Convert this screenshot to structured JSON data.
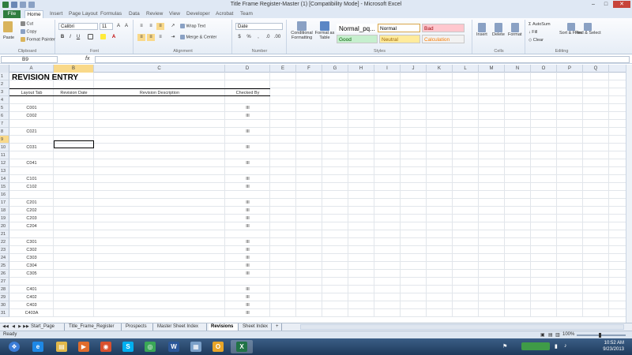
{
  "window": {
    "title": "Title Frame Register-Master (1) [Compatibility Mode] - Microsoft Excel"
  },
  "ribbon": {
    "tabs": [
      "File",
      "Home",
      "Insert",
      "Page Layout",
      "Formulas",
      "Data",
      "Review",
      "View",
      "Developer",
      "Acrobat",
      "Team"
    ],
    "clipboard": {
      "paste": "Paste",
      "cut": "Cut",
      "copy": "Copy",
      "format_painter": "Format Painter",
      "label": "Clipboard"
    },
    "font": {
      "name": "Calibri",
      "size": "11",
      "label": "Font"
    },
    "alignment": {
      "wrap_text": "Wrap Text",
      "merge_center": "Merge & Center",
      "label": "Alignment"
    },
    "number": {
      "format": "Date",
      "label": "Number"
    },
    "styles": {
      "conditional": "Conditional Formatting",
      "format_as_table": "Format as Table",
      "cell_styles": [
        {
          "name": "Normal_pq...",
          "bg": "#ffffff",
          "fg": "#000000"
        },
        {
          "name": "Normal",
          "bg": "#ffffff",
          "fg": "#000000"
        },
        {
          "name": "Bad",
          "bg": "#ffc7ce",
          "fg": "#9c0006"
        },
        {
          "name": "Good",
          "bg": "#c6efce",
          "fg": "#006100"
        },
        {
          "name": "Neutral",
          "bg": "#ffeb9c",
          "fg": "#9c6500"
        },
        {
          "name": "Calculation",
          "bg": "#f2f2f2",
          "fg": "#fa7d00"
        }
      ],
      "label": "Styles"
    },
    "cells": {
      "insert": "Insert",
      "delete": "Delete",
      "format": "Format",
      "label": "Cells"
    },
    "editing": {
      "autosum": "AutoSum",
      "fill": "Fill",
      "clear": "Clear",
      "sort_filter": "Sort & Filter",
      "find_select": "Find & Select",
      "label": "Editing"
    }
  },
  "formula_bar": {
    "name_box": "B9",
    "fx": "fx",
    "value": ""
  },
  "sheet": {
    "columns": [
      "A",
      "B",
      "C",
      "D",
      "E",
      "F",
      "G",
      "H",
      "I",
      "J",
      "K",
      "L",
      "M",
      "N",
      "O",
      "P",
      "Q"
    ],
    "selected_column": "B",
    "selected_row": "9",
    "title": "REVISION ENTRY",
    "headers": {
      "layout_tab": "Layout Tab",
      "revision_date": "Revision Date",
      "revision_description": "Revision Description",
      "checked_by": "Checked By"
    },
    "rows": [
      {
        "n": "1",
        "a": "",
        "d": ""
      },
      {
        "n": "2",
        "a": "",
        "d": ""
      },
      {
        "n": "3",
        "a": "",
        "d": ""
      },
      {
        "n": "4",
        "a": "",
        "d": ""
      },
      {
        "n": "5",
        "a": "C001",
        "d": "III"
      },
      {
        "n": "6",
        "a": "C002",
        "d": "III"
      },
      {
        "n": "7",
        "a": "",
        "d": ""
      },
      {
        "n": "8",
        "a": "C021",
        "d": "III"
      },
      {
        "n": "9",
        "a": "",
        "d": ""
      },
      {
        "n": "10",
        "a": "C031",
        "d": "III"
      },
      {
        "n": "11",
        "a": "",
        "d": ""
      },
      {
        "n": "12",
        "a": "C041",
        "d": "III"
      },
      {
        "n": "13",
        "a": "",
        "d": ""
      },
      {
        "n": "14",
        "a": "C101",
        "d": "III"
      },
      {
        "n": "15",
        "a": "C102",
        "d": "III"
      },
      {
        "n": "16",
        "a": "",
        "d": ""
      },
      {
        "n": "17",
        "a": "C201",
        "d": "III"
      },
      {
        "n": "18",
        "a": "C202",
        "d": "III"
      },
      {
        "n": "19",
        "a": "C203",
        "d": "III"
      },
      {
        "n": "20",
        "a": "C204",
        "d": "III"
      },
      {
        "n": "21",
        "a": "",
        "d": ""
      },
      {
        "n": "22",
        "a": "C301",
        "d": "III"
      },
      {
        "n": "23",
        "a": "C302",
        "d": "III"
      },
      {
        "n": "24",
        "a": "C303",
        "d": "III"
      },
      {
        "n": "25",
        "a": "C304",
        "d": "III"
      },
      {
        "n": "26",
        "a": "C305",
        "d": "III"
      },
      {
        "n": "27",
        "a": "",
        "d": ""
      },
      {
        "n": "28",
        "a": "C401",
        "d": "III"
      },
      {
        "n": "29",
        "a": "C402",
        "d": "III"
      },
      {
        "n": "30",
        "a": "C403",
        "d": "III"
      },
      {
        "n": "31",
        "a": "C403A",
        "d": "III"
      }
    ]
  },
  "sheet_tabs": [
    "Start_Page",
    "Title_Frame_Register",
    "Prospects",
    "Master Sheet Index",
    "Revisions",
    "Sheet Index"
  ],
  "active_sheet": "Revisions",
  "status": {
    "ready": "Ready",
    "zoom": "100%"
  },
  "taskbar": {
    "apps": [
      "start",
      "ie",
      "explorer",
      "media",
      "chrome-orange",
      "skype",
      "chrome",
      "word",
      "misc",
      "outlook",
      "excel"
    ],
    "time": "10:52 AM",
    "date": "9/23/2013"
  }
}
